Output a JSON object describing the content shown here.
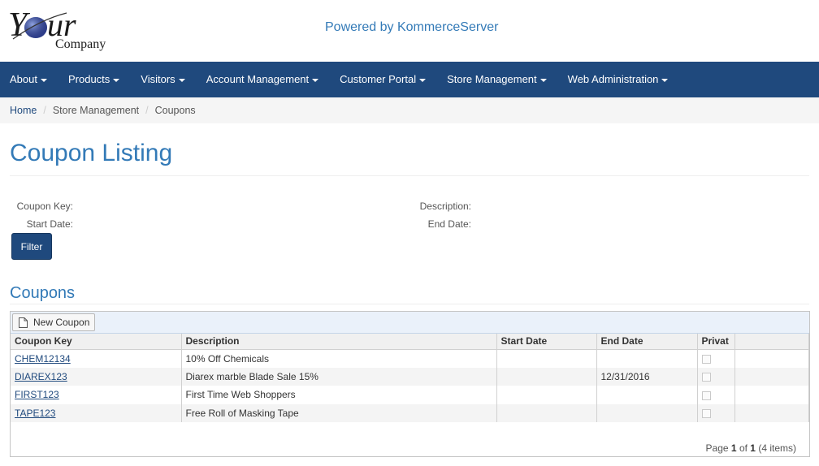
{
  "header": {
    "logo_word": "Your",
    "logo_sub": "Company",
    "powered_by": "Powered by KommerceServer"
  },
  "nav": {
    "items": [
      {
        "label": "About"
      },
      {
        "label": "Products"
      },
      {
        "label": "Visitors"
      },
      {
        "label": "Account Management"
      },
      {
        "label": "Customer Portal"
      },
      {
        "label": "Store Management"
      },
      {
        "label": "Web Administration"
      }
    ]
  },
  "breadcrumb": {
    "home": "Home",
    "section": "Store Management",
    "current": "Coupons"
  },
  "page": {
    "title": "Coupon Listing"
  },
  "filter": {
    "coupon_key_label": "Coupon Key:",
    "description_label": "Description:",
    "start_date_label": "Start Date:",
    "end_date_label": "End Date:",
    "button_label": "Filter"
  },
  "coupons": {
    "section_title": "Coupons",
    "new_button_label": "New Coupon",
    "columns": [
      "Coupon Key",
      "Description",
      "Start Date",
      "End Date",
      "Privat"
    ],
    "rows": [
      {
        "key": "CHEM12134",
        "description": "10% Off Chemicals",
        "start_date": "",
        "end_date": "",
        "private": false
      },
      {
        "key": "DIAREX123",
        "description": "Diarex marble Blade Sale 15%",
        "start_date": "",
        "end_date": "12/31/2016",
        "private": false
      },
      {
        "key": "FIRST123",
        "description": "First Time Web Shoppers",
        "start_date": "",
        "end_date": "",
        "private": false
      },
      {
        "key": "TAPE123",
        "description": "Free Roll of Masking Tape",
        "start_date": "",
        "end_date": "",
        "private": false
      }
    ],
    "pager": {
      "page_word": "Page",
      "current_page": "1",
      "of_word": "of",
      "total_pages": "1",
      "items_text": "(4 items)"
    }
  },
  "colors": {
    "navbar": "#1f497d",
    "accent": "#337ab7",
    "link": "#1f497d"
  }
}
